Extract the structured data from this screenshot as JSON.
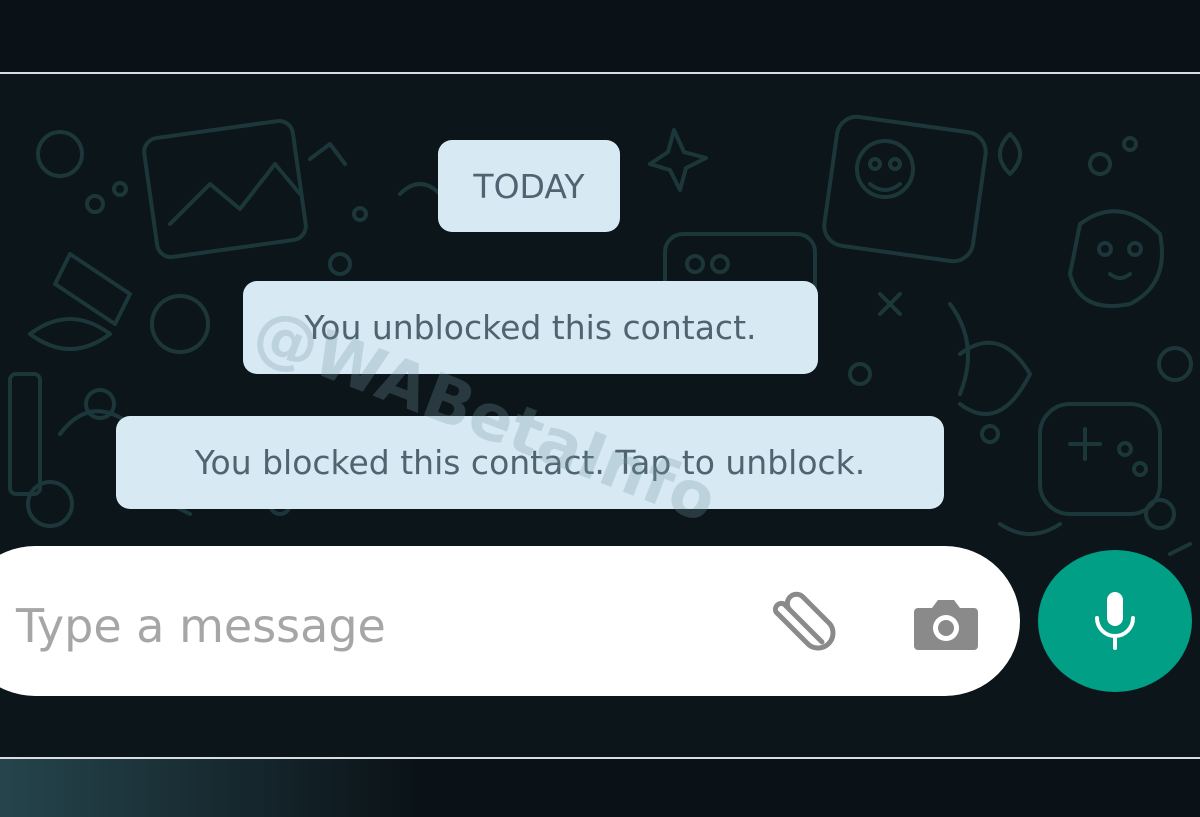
{
  "chat": {
    "date_label": "TODAY",
    "system_messages": [
      {
        "text": "You unblocked this contact."
      },
      {
        "text": "You blocked this contact. Tap to unblock."
      }
    ],
    "watermark": "@WABetaInfo"
  },
  "composer": {
    "placeholder": "Type a message",
    "attach_icon": "paperclip-icon",
    "camera_icon": "camera-icon",
    "mic_icon": "microphone-icon"
  },
  "colors": {
    "background": "#0b141a",
    "system_bubble": "#d7e9f3",
    "system_text": "#4f6470",
    "accent": "#009f86",
    "composer_bg": "#ffffff",
    "placeholder_text": "#a6a6a6"
  }
}
